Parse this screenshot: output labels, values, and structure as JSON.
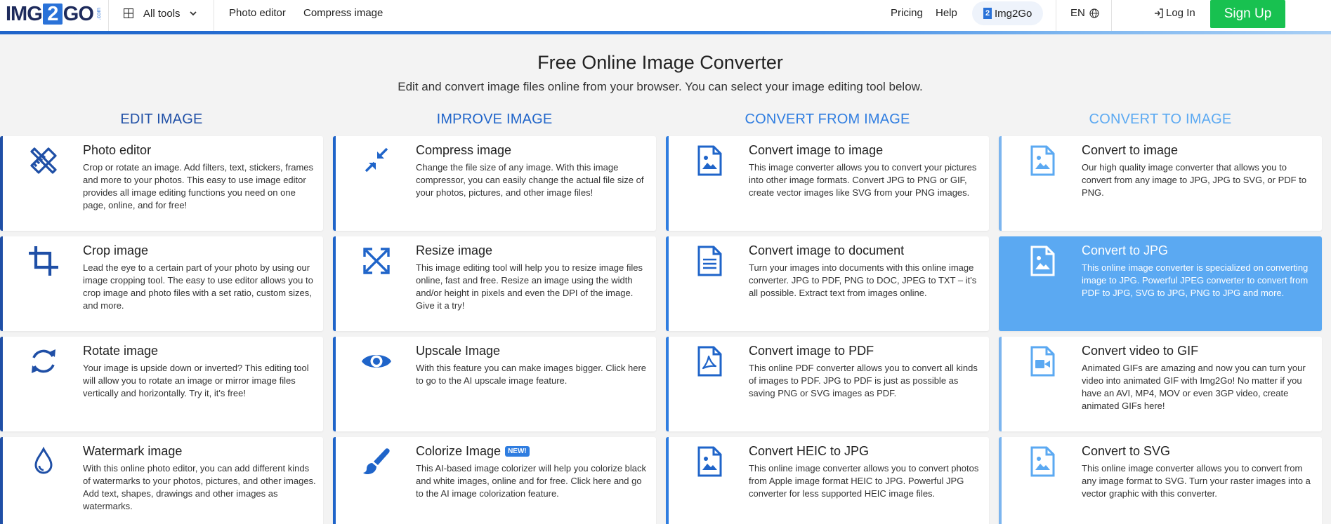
{
  "header": {
    "logo": {
      "text_a": "IMG",
      "text_b": "2",
      "text_c": "GO",
      "suffix": ".com"
    },
    "all_tools": "All tools",
    "nav": [
      "Photo editor",
      "Compress image"
    ],
    "pricing": "Pricing",
    "help": "Help",
    "brand_pill": "Img2Go",
    "brand_pill_icon": "2",
    "lang": "EN",
    "login": "Log In",
    "signup": "Sign Up",
    "colors": {
      "accent": "#1f64c9",
      "signup": "#18c150",
      "active_card": "#5ba9f2"
    }
  },
  "hero": {
    "title": "Free Online Image Converter",
    "subtitle": "Edit and convert image files online from your browser. You can select your image editing tool below."
  },
  "columns": [
    {
      "heading": "EDIT IMAGE",
      "color": "#1f4fa6",
      "cards": [
        {
          "icon": "pencil-ruler-icon",
          "title": "Photo editor",
          "desc": "Crop or rotate an image. Add filters, text, stickers, frames and more to your photos. This easy to use image editor provides all image editing functions you need on one page, online, and for free!"
        },
        {
          "icon": "crop-icon",
          "title": "Crop image",
          "desc": "Lead the eye to a certain part of your photo by using our image cropping tool. The easy to use editor allows you to crop image and photo files with a set ratio, custom sizes, and more."
        },
        {
          "icon": "rotate-icon",
          "title": "Rotate image",
          "desc": "Your image is upside down or inverted? This editing tool will allow you to rotate an image or mirror image files vertically and horizontally. Try it, it's free!"
        },
        {
          "icon": "watermark-drop-icon",
          "title": "Watermark image",
          "desc": "With this online photo editor, you can add different kinds of watermarks to your photos, pictures, and other images. Add text, shapes, drawings and other images as watermarks."
        }
      ]
    },
    {
      "heading": "IMPROVE IMAGE",
      "color": "#1f64c9",
      "cards": [
        {
          "icon": "compress-arrows-icon",
          "title": "Compress image",
          "desc": "Change the file size of any image. With this image compressor, you can easily change the actual file size of your photos, pictures, and other image files!"
        },
        {
          "icon": "resize-arrows-icon",
          "title": "Resize image",
          "desc": "This image editing tool will help you to resize image files online, fast and free. Resize an image using the width and/or height in pixels and even the DPI of the image. Give it a try!"
        },
        {
          "icon": "eye-icon",
          "title": "Upscale Image",
          "desc": "With this feature you can make images bigger. Click here to go to the AI upscale image feature."
        },
        {
          "icon": "paintbrush-icon",
          "title": "Colorize Image",
          "badge": "NEW!",
          "desc": "This AI-based image colorizer will help you colorize black and white images, online and for free. Click here and go to the AI image colorization feature."
        }
      ]
    },
    {
      "heading": "CONVERT FROM IMAGE",
      "color": "#2f7de0",
      "cards": [
        {
          "icon": "image-file-icon",
          "title": "Convert image to image",
          "desc": "This image converter allows you to convert your pictures into other image formats. Convert JPG to PNG or GIF, create vector images like SVG from your PNG images."
        },
        {
          "icon": "document-file-icon",
          "title": "Convert image to document",
          "desc": "Turn your images into documents with this online image converter. JPG to PDF, PNG to DOC, JPEG to TXT – it's all possible. Extract text from images online."
        },
        {
          "icon": "pdf-file-icon",
          "title": "Convert image to PDF",
          "desc": "This online PDF converter allows you to convert all kinds of images to PDF. JPG to PDF is just as possible as saving PNG or SVG images as PDF."
        },
        {
          "icon": "image-file-icon",
          "title": "Convert HEIC to JPG",
          "desc": "This online image converter allows you to convert photos from Apple image format HEIC to JPG. Powerful JPG converter for less supported HEIC image files."
        }
      ]
    },
    {
      "heading": "CONVERT TO IMAGE",
      "color": "#5ba9f2",
      "cards": [
        {
          "icon": "image-file-icon",
          "title": "Convert to image",
          "desc": "Our high quality image converter that allows you to convert from any image to JPG, JPG to SVG, or PDF to PNG."
        },
        {
          "icon": "image-file-icon",
          "title": "Convert to JPG",
          "active": true,
          "desc": "This online image converter is specialized on converting image to JPG. Powerful JPEG converter to convert from PDF to JPG, SVG to JPG, PNG to JPG and more."
        },
        {
          "icon": "video-file-icon",
          "title": "Convert video to GIF",
          "desc": "Animated GIFs are amazing and now you can turn your video into animated GIF with Img2Go! No matter if you have an AVI, MP4, MOV or even 3GP video, create animated GIFs here!"
        },
        {
          "icon": "image-file-icon",
          "title": "Convert to SVG",
          "desc": "This online image converter allows you to convert from any image format to SVG. Turn your raster images into a vector graphic with this converter."
        }
      ]
    }
  ]
}
